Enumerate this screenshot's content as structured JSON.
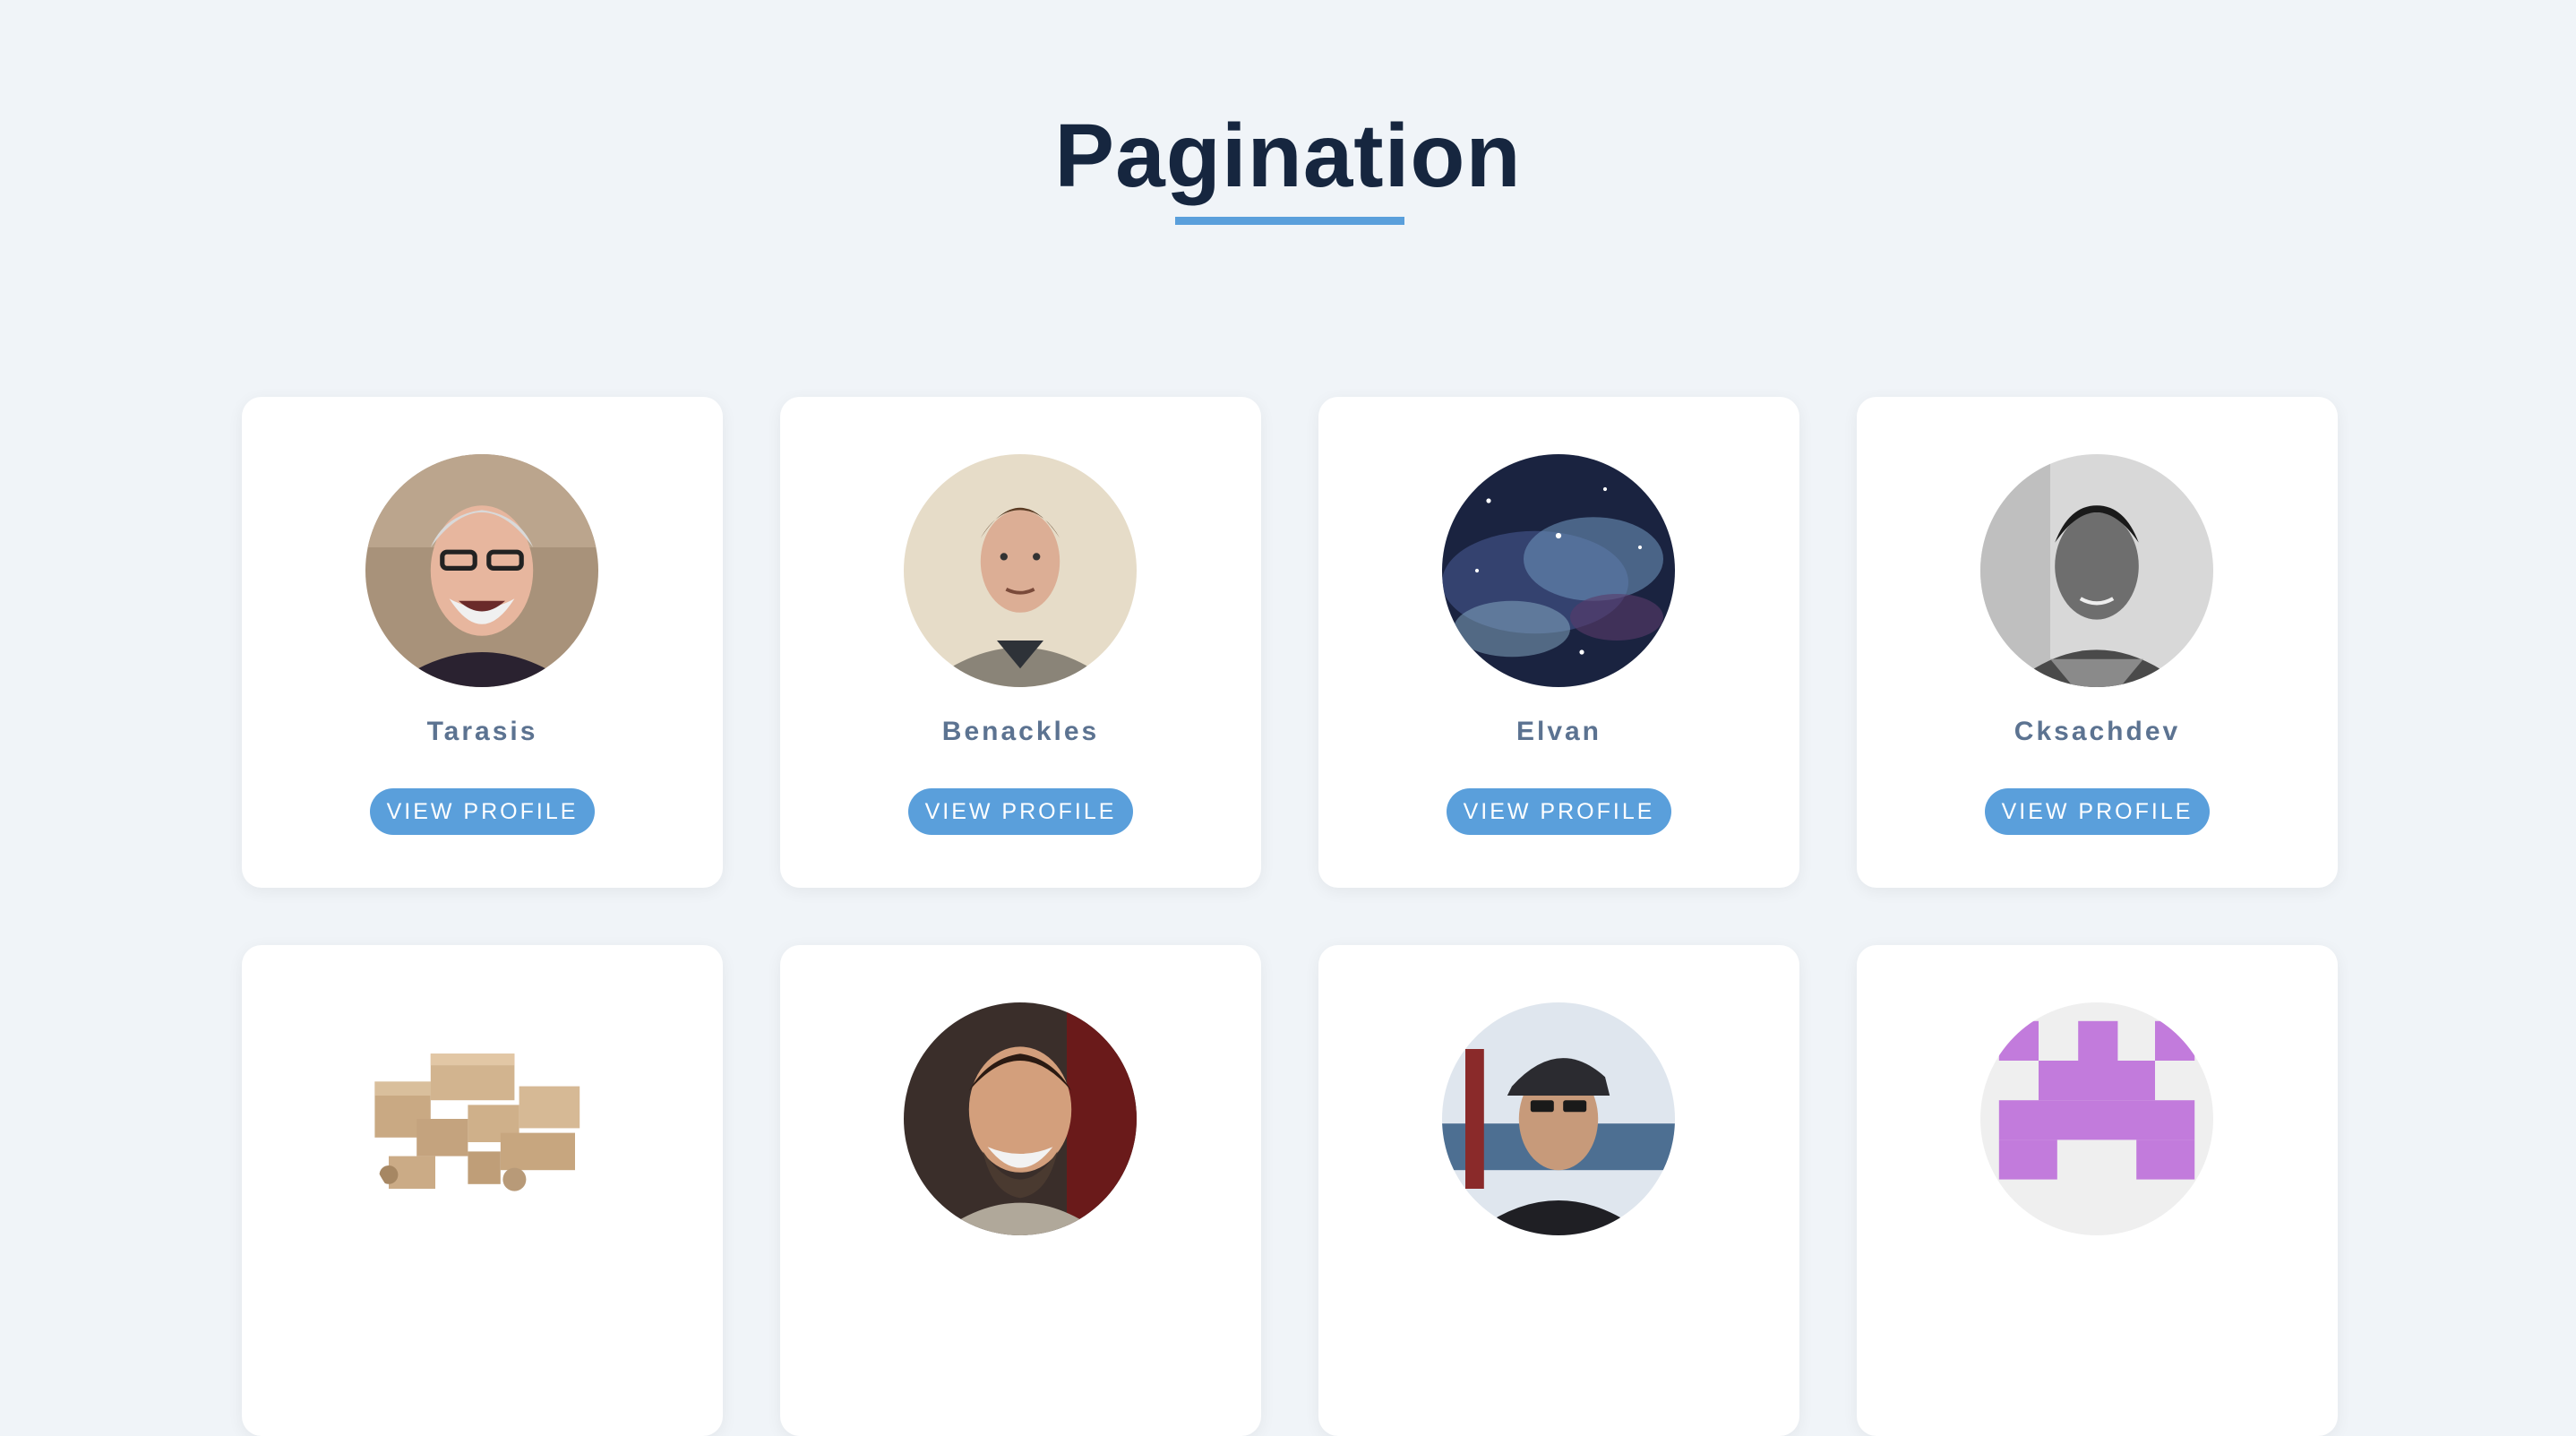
{
  "page": {
    "title": "Pagination"
  },
  "profiles": [
    {
      "name": "Tarasis",
      "button": "VIEW PROFILE",
      "avatar": "avatar-smiling-man-glasses"
    },
    {
      "name": "Benackles",
      "button": "VIEW PROFILE",
      "avatar": "avatar-young-man"
    },
    {
      "name": "Elvan",
      "button": "VIEW PROFILE",
      "avatar": "avatar-galaxy"
    },
    {
      "name": "Cksachdev",
      "button": "VIEW PROFILE",
      "avatar": "avatar-man-grayscale"
    },
    {
      "name": "",
      "button": "",
      "avatar": "avatar-cardboard-boxes"
    },
    {
      "name": "",
      "button": "",
      "avatar": "avatar-bearded-man"
    },
    {
      "name": "",
      "button": "",
      "avatar": "avatar-man-cap"
    },
    {
      "name": "",
      "button": "",
      "avatar": "avatar-purple-identicon"
    }
  ],
  "colors": {
    "background": "#f0f4f8",
    "title": "#16263f",
    "accent": "#5a9fdb",
    "name": "#5c7391",
    "card": "#ffffff",
    "identicon": "#c27bdc"
  }
}
